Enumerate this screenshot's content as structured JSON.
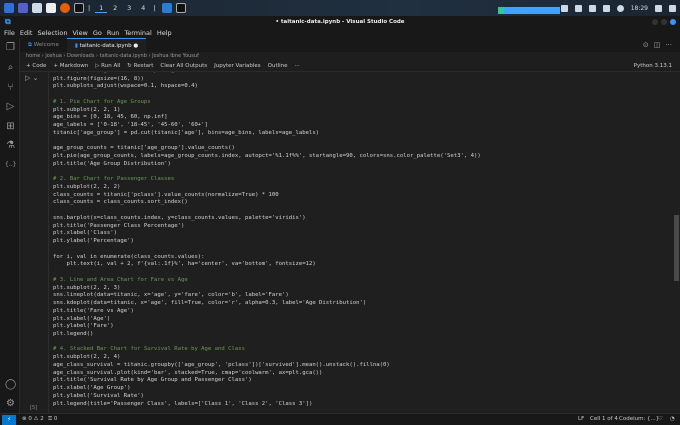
{
  "taskbar": {
    "workspaces": [
      "1",
      "2",
      "3",
      "4"
    ],
    "clock": "18:29"
  },
  "window": {
    "title": "• taitanic-data.ipynb - Visual Studio Code"
  },
  "menu": [
    "File",
    "Edit",
    "Selection",
    "View",
    "Go",
    "Run",
    "Terminal",
    "Help"
  ],
  "tabs": [
    {
      "label": "Welcome"
    },
    {
      "label": "taitanic-data.ipynb ●"
    }
  ],
  "breadcrumb": "home › joshua › Downloads › taitanic-data.ipynb › Joshua Ibne Yousuf",
  "toolbar": {
    "code": "+ Code",
    "markdown": "+ Markdown",
    "run_all": "▷ Run All",
    "restart": "↻ Restart",
    "clear": "Clear All Outputs",
    "variables": "Jupyter Variables",
    "outline": "Outline",
    "more": "···",
    "kernel": "Python 3.13.1"
  },
  "cell": {
    "exec_count": "[5]"
  },
  "code_lines": [
    "# Set up the figure size and spacing",
    "plt.figure(figsize=(16, 8))",
    "plt.subplots_adjust(wspace=0.1, hspace=0.4)",
    "",
    "# 1. Pie Chart for Age Groups",
    "plt.subplot(2, 2, 1)",
    "age_bins = [0, 18, 45, 60, np.inf]",
    "age_labels = ['0-18', '18-45', '45-60', '60+']",
    "titanic['age_group'] = pd.cut(titanic['age'], bins=age_bins, labels=age_labels)",
    "",
    "age_group_counts = titanic['age_group'].value_counts()",
    "plt.pie(age_group_counts, labels=age_group_counts.index, autopct='%1.1f%%', startangle=90, colors=sns.color_palette('Set3', 4))",
    "plt.title('Age Group Distribution')",
    "",
    "# 2. Bar Chart for Passenger Classes",
    "plt.subplot(2, 2, 2)",
    "class_counts = titanic['pclass'].value_counts(normalize=True) * 100",
    "class_counts = class_counts.sort_index()",
    "",
    "sns.barplot(x=class_counts.index, y=class_counts.values, palette='viridis')",
    "plt.title('Passenger Class Percentage')",
    "plt.xlabel('Class')",
    "plt.ylabel('Percentage')",
    "",
    "for i, val in enumerate(class_counts.values):",
    "    plt.text(i, val + 2, f'{val:.1f}%', ha='center', va='bottom', fontsize=12)",
    "",
    "# 3. Line and Area Chart for Fare vs Age",
    "plt.subplot(2, 2, 3)",
    "sns.lineplot(data=titanic, x='age', y='fare', color='b', label='Fare')",
    "sns.kdeplot(data=titanic, x='age', fill=True, color='r', alpha=0.3, label='Age Distribution')",
    "plt.title('Fare vs Age')",
    "plt.xlabel('Age')",
    "plt.ylabel('Fare')",
    "plt.legend()",
    "",
    "# 4. Stacked Bar Chart for Survival Rate by Age and Class",
    "plt.subplot(2, 2, 4)",
    "age_class_survival = titanic.groupby(['age_group', 'pclass'])['survived'].mean().unstack().fillna(0)",
    "age_class_survival.plot(kind='bar', stacked=True, cmap='coolwarm', ax=plt.gca())",
    "plt.title('Survival Rate by Age Group and Passenger Class')",
    "plt.xlabel('Age Group')",
    "plt.ylabel('Survival Rate')",
    "plt.legend(title='Passenger Class', labels=['Class 1', 'Class 2', 'Class 3'])"
  ],
  "status": {
    "remote": "⚡",
    "problems": "⊗ 0 ⚠ 2",
    "ports": "⚿ 0",
    "eol": "LF",
    "cell": "Cell 1 of 4",
    "codeium": "Codeium: {...}"
  },
  "scroll": {
    "position_fraction": 0.45
  }
}
